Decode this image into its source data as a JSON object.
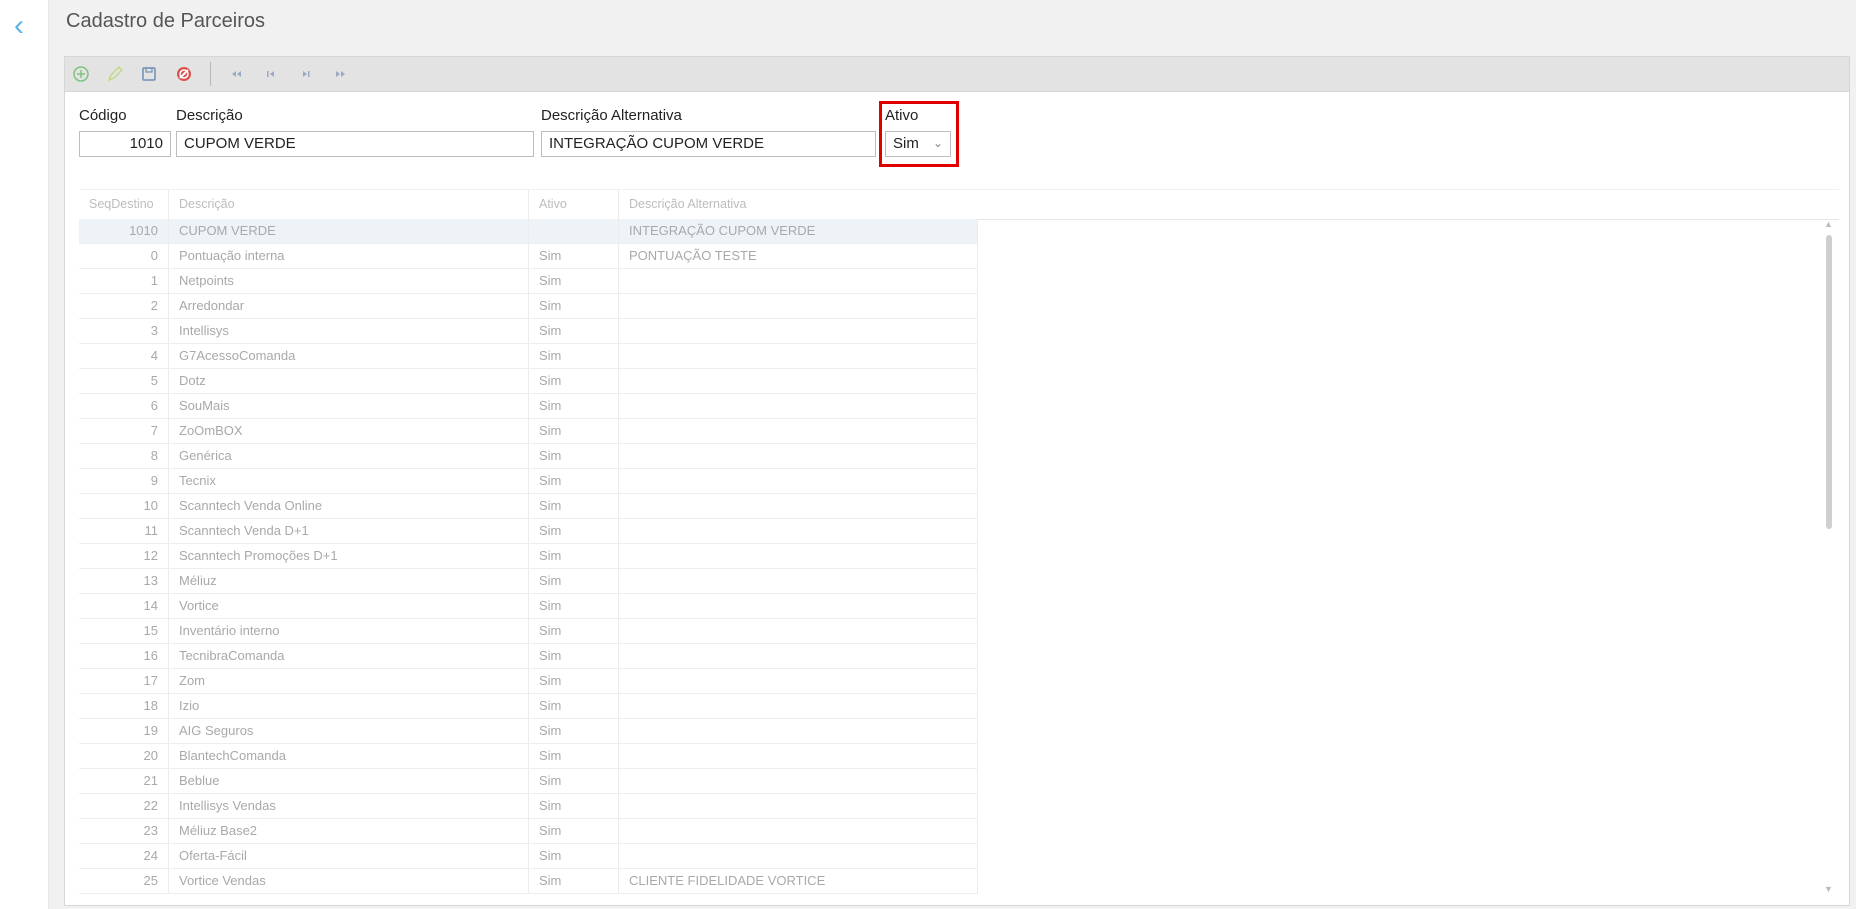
{
  "header": {
    "title": "Cadastro de Parceiros",
    "back_icon": "chevron-left-icon"
  },
  "toolbar": {
    "buttons": [
      {
        "name": "add-icon",
        "color": "#7cc47c"
      },
      {
        "name": "edit-icon",
        "color": "#c3d98a"
      },
      {
        "name": "save-icon",
        "color": "#6d8fb5"
      },
      {
        "name": "cancel-icon",
        "color": "#d9534f"
      },
      {
        "name": "first-record-icon",
        "color": "#9aa9c4"
      },
      {
        "name": "previous-record-icon",
        "color": "#9aa9c4"
      },
      {
        "name": "next-record-icon",
        "color": "#9aa9c4"
      },
      {
        "name": "last-record-icon",
        "color": "#9aa9c4"
      }
    ]
  },
  "form": {
    "codigo_label": "Código",
    "codigo_value": "1010",
    "descricao_label": "Descrição",
    "descricao_value": "CUPOM VERDE",
    "desc_alt_label": "Descrição Alternativa",
    "desc_alt_value": "INTEGRAÇÃO CUPOM VERDE",
    "ativo_label": "Ativo",
    "ativo_value": "Sim"
  },
  "grid": {
    "columns": [
      "SeqDestino",
      "Descrição",
      "Ativo",
      "Descrição Alternativa"
    ],
    "rows": [
      {
        "seq": "1010",
        "desc": "CUPOM VERDE",
        "ativo": "",
        "alt": "INTEGRAÇÃO CUPOM VERDE",
        "selected": true
      },
      {
        "seq": "0",
        "desc": "Pontuação interna",
        "ativo": "Sim",
        "alt": "PONTUAÇÃO TESTE"
      },
      {
        "seq": "1",
        "desc": "Netpoints",
        "ativo": "Sim",
        "alt": ""
      },
      {
        "seq": "2",
        "desc": "Arredondar",
        "ativo": "Sim",
        "alt": ""
      },
      {
        "seq": "3",
        "desc": "Intellisys",
        "ativo": "Sim",
        "alt": ""
      },
      {
        "seq": "4",
        "desc": "G7AcessoComanda",
        "ativo": "Sim",
        "alt": ""
      },
      {
        "seq": "5",
        "desc": "Dotz",
        "ativo": "Sim",
        "alt": ""
      },
      {
        "seq": "6",
        "desc": "SouMais",
        "ativo": "Sim",
        "alt": ""
      },
      {
        "seq": "7",
        "desc": "ZoOmBOX",
        "ativo": "Sim",
        "alt": ""
      },
      {
        "seq": "8",
        "desc": "Genérica",
        "ativo": "Sim",
        "alt": ""
      },
      {
        "seq": "9",
        "desc": "Tecnix",
        "ativo": "Sim",
        "alt": ""
      },
      {
        "seq": "10",
        "desc": "Scanntech Venda Online",
        "ativo": "Sim",
        "alt": ""
      },
      {
        "seq": "11",
        "desc": "Scanntech Venda D+1",
        "ativo": "Sim",
        "alt": ""
      },
      {
        "seq": "12",
        "desc": "Scanntech Promoções D+1",
        "ativo": "Sim",
        "alt": ""
      },
      {
        "seq": "13",
        "desc": "Méliuz",
        "ativo": "Sim",
        "alt": ""
      },
      {
        "seq": "14",
        "desc": "Vortice",
        "ativo": "Sim",
        "alt": ""
      },
      {
        "seq": "15",
        "desc": "Inventário interno",
        "ativo": "Sim",
        "alt": ""
      },
      {
        "seq": "16",
        "desc": "TecnibraComanda",
        "ativo": "Sim",
        "alt": ""
      },
      {
        "seq": "17",
        "desc": "Zom",
        "ativo": "Sim",
        "alt": ""
      },
      {
        "seq": "18",
        "desc": "Izio",
        "ativo": "Sim",
        "alt": ""
      },
      {
        "seq": "19",
        "desc": "AIG Seguros",
        "ativo": "Sim",
        "alt": ""
      },
      {
        "seq": "20",
        "desc": "BlantechComanda",
        "ativo": "Sim",
        "alt": ""
      },
      {
        "seq": "21",
        "desc": "Beblue",
        "ativo": "Sim",
        "alt": ""
      },
      {
        "seq": "22",
        "desc": "Intellisys Vendas",
        "ativo": "Sim",
        "alt": ""
      },
      {
        "seq": "23",
        "desc": "Méliuz Base2",
        "ativo": "Sim",
        "alt": ""
      },
      {
        "seq": "24",
        "desc": "Oferta-Fácil",
        "ativo": "Sim",
        "alt": ""
      },
      {
        "seq": "25",
        "desc": "Vortice Vendas",
        "ativo": "Sim",
        "alt": "CLIENTE FIDELIDADE VORTICE"
      }
    ]
  }
}
